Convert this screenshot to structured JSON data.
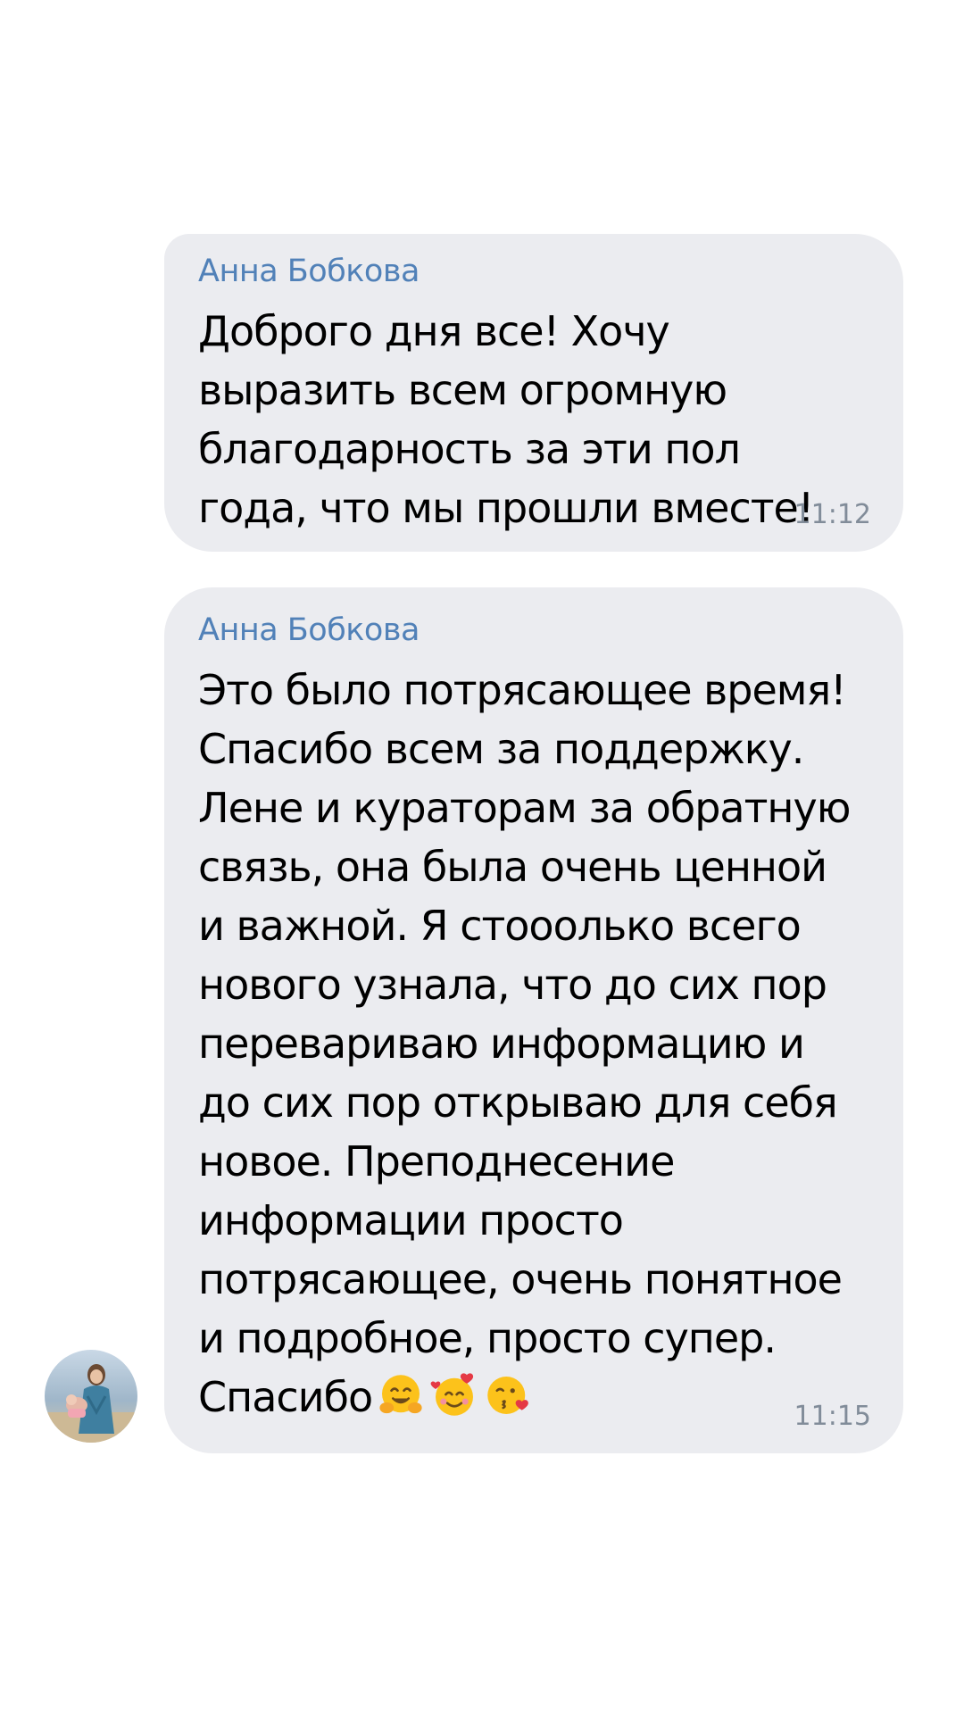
{
  "messages": [
    {
      "sender": "Анна Бобкова",
      "text": "Доброго дня все! Хочу выразить всем огромную благодарность за эти пол года, что мы прошли вместе!",
      "time": "11:12"
    },
    {
      "sender": "Анна Бобкова",
      "text": "Это было потрясающее время! Спасибо всем за поддержку. Лене и кураторам за обратную связь, она была очень ценной и важной. Я стооолько всего нового узнала, что до сих пор перевариваю информацию и до сих пор открываю для себя новое. Преподнесение информации просто потрясающее, очень понятное и подробное, просто супер. Спасибо",
      "emojis": [
        "hugging-face-icon",
        "smiling-face-with-hearts-icon",
        "face-blowing-kiss-icon"
      ],
      "time": "11:15"
    }
  ],
  "colors": {
    "sender": "#5181b8",
    "bubble": "#ebecf0",
    "time": "#818c99",
    "text": "#000000"
  }
}
